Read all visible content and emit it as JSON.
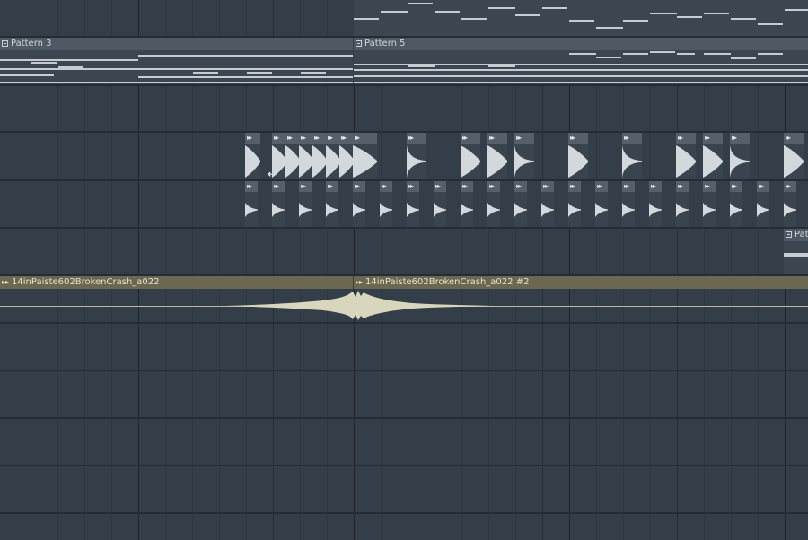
{
  "playlist": {
    "clips": {
      "pattern_3": "Pattern 3",
      "pattern_5": "Pattern 5",
      "pattern_partial": "Pat",
      "audio_1": "14inPaiste602BrokenCrash_a022",
      "audio_2": "14inPaiste602BrokenCrash_a022 #2"
    },
    "icons": {
      "pattern": "pattern-clip-icon",
      "audio": "audio-clip-arrow-icon",
      "cursor": "resize-cursor-icon"
    },
    "colors": {
      "background": "#343e49",
      "clip_header": "#4f5963",
      "audio_header": "#6b6750",
      "waveform": "#d8d6bd",
      "notes": "#c6ccd2"
    }
  }
}
